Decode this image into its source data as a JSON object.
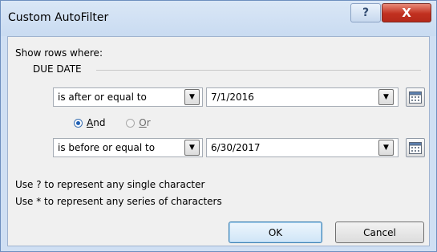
{
  "dialog": {
    "title": "Custom AutoFilter",
    "help_glyph": "?",
    "close_glyph": "X"
  },
  "content": {
    "show_rows_label": "Show rows where:",
    "column_name": "DUE DATE"
  },
  "criteria": [
    {
      "operator": "is after or equal to",
      "value": "7/1/2016"
    },
    {
      "operator": "is before or equal to",
      "value": "6/30/2017"
    }
  ],
  "logic": {
    "and_label_accel": "A",
    "and_label_rest": "nd",
    "or_label_accel": "O",
    "or_label_rest": "r",
    "selected": "And"
  },
  "hints": {
    "single": "Use ? to represent any single character",
    "series": "Use * to represent any series of characters"
  },
  "buttons": {
    "ok": "OK",
    "cancel": "Cancel"
  },
  "icons": {
    "dropdown": "chevron-down-icon",
    "date_picker": "calendar-icon"
  },
  "colors": {
    "frame": "#cfdff3",
    "close": "#c1301f",
    "client": "#f0f0f0",
    "radio_selected": "#1f5fb4"
  }
}
